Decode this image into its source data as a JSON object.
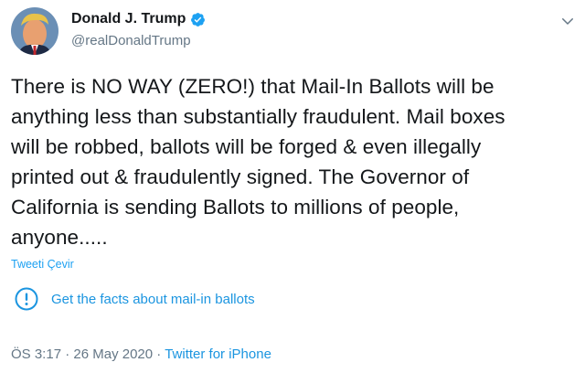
{
  "author": {
    "display_name": "Donald J. Trump",
    "handle": "@realDonaldTrump",
    "verified": true
  },
  "tweet": {
    "text": "There is NO WAY (ZERO!) that Mail-In Ballots will be\nanything less than substantially fraudulent. Mail boxes\nwill be robbed, ballots will be forged & even illegally\nprinted out & fraudulently signed. The Governor of\nCalifornia is sending Ballots to millions of people,\nanyone.....",
    "translate_label": "Tweeti Çevir"
  },
  "fact_check": {
    "label": "Get the facts about mail-in ballots",
    "icon": "exclamation-circle-icon"
  },
  "meta": {
    "time": "ÖS 3:17",
    "separator": " · ",
    "date": "26 May 2020",
    "source": "Twitter for iPhone"
  },
  "colors": {
    "link": "#1b95e0",
    "verified": "#1da1f2",
    "secondary": "#657786"
  }
}
